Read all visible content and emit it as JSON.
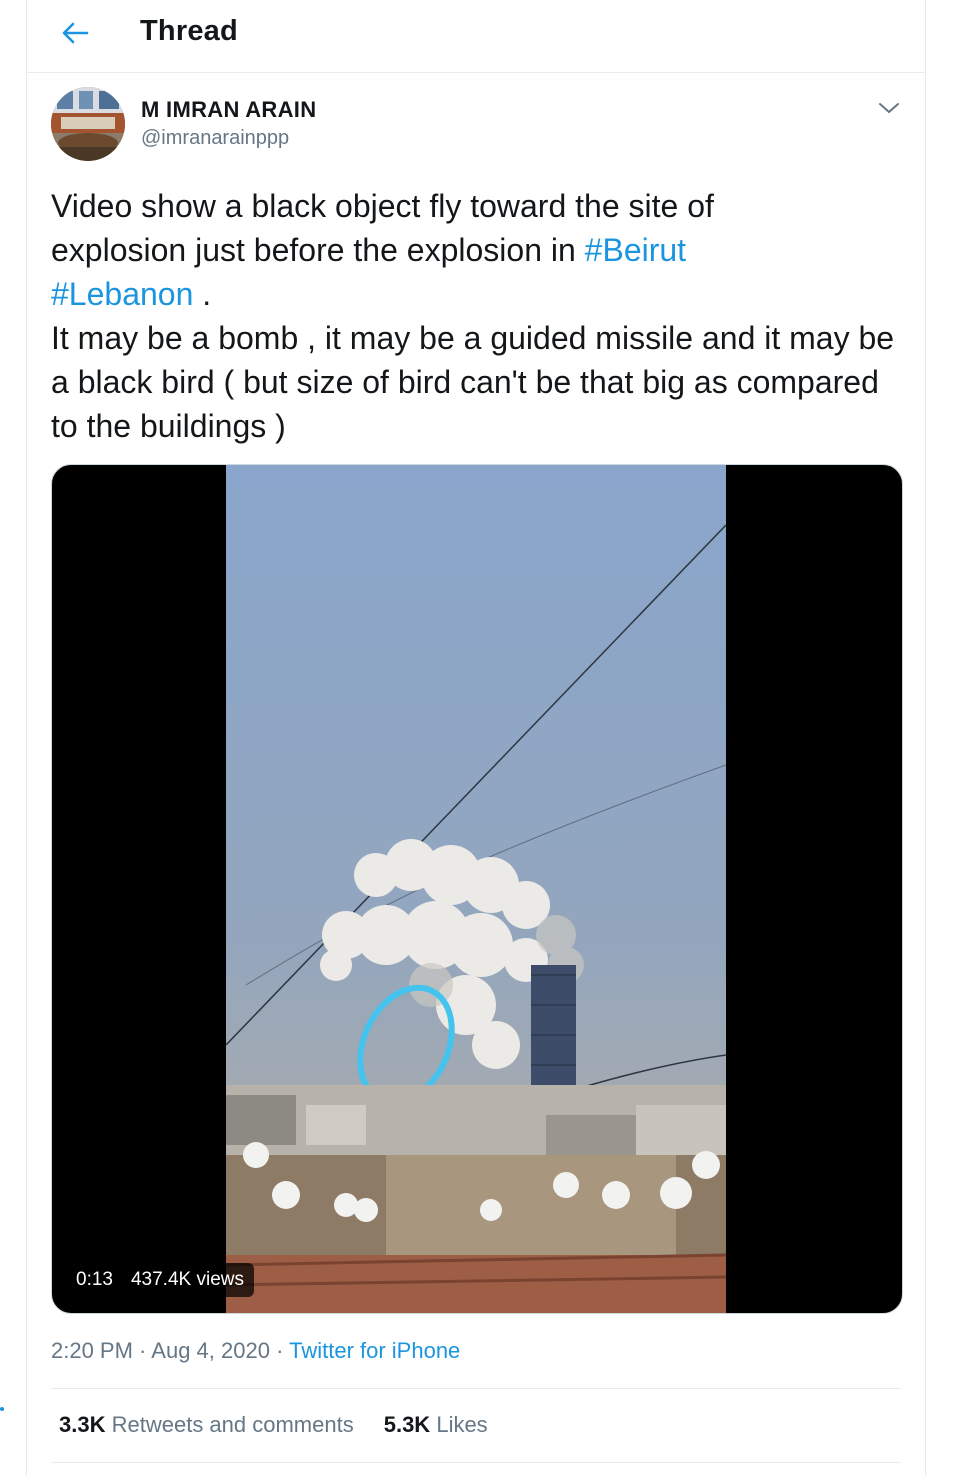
{
  "header": {
    "title": "Thread",
    "back_icon": "arrow-left-icon",
    "accent": "#1b95e0"
  },
  "tweet": {
    "author": {
      "name": "M IMRAN ARAIN",
      "handle": "@imranarainppp"
    },
    "caret_icon": "chevron-down-icon",
    "text": {
      "l1": "Video show a black object fly toward the site of",
      "l2_prefix": "explosion just before the explosion in ",
      "hashtag1": "#Beirut",
      "hashtag2": "#Lebanon",
      "l3_suffix": " .",
      "p2": "It may be a bomb , it may be a guided missile and it may be a black bird ( but size of bird can't be that big as compared to the buildings )"
    },
    "media": {
      "duration": "0:13",
      "views": "437.4K views"
    },
    "meta": {
      "time": "2:20 PM",
      "sep1": " · ",
      "date": "Aug 4, 2020",
      "sep2": " · ",
      "source": "Twitter for iPhone"
    },
    "stats": {
      "retweets_count": "3.3K",
      "retweets_label": "Retweets and comments",
      "likes_count": "5.3K",
      "likes_label": "Likes"
    }
  }
}
